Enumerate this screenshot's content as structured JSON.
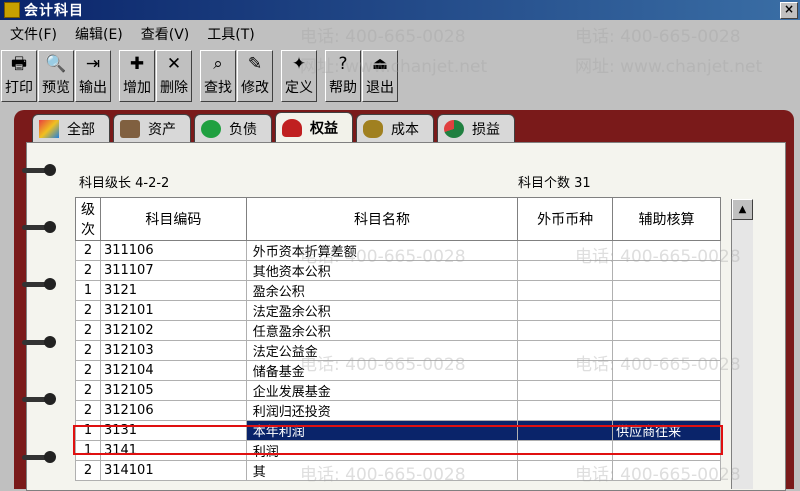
{
  "window": {
    "title": "会计科目",
    "close_label": "×"
  },
  "menu": [
    "文件(F)",
    "编辑(E)",
    "查看(V)",
    "工具(T)"
  ],
  "toolbar": [
    {
      "label": "打印",
      "icon": "printer-icon",
      "glyph": "🖶"
    },
    {
      "label": "预览",
      "icon": "preview-icon",
      "glyph": "🔍"
    },
    {
      "label": "输出",
      "icon": "export-icon",
      "glyph": "⇥"
    },
    {
      "label": "增加",
      "icon": "add-icon",
      "glyph": "✚"
    },
    {
      "label": "删除",
      "icon": "delete-icon",
      "glyph": "✕"
    },
    {
      "label": "查找",
      "icon": "find-icon",
      "glyph": "⌕"
    },
    {
      "label": "修改",
      "icon": "edit-icon",
      "glyph": "✎"
    },
    {
      "label": "定义",
      "icon": "define-icon",
      "glyph": "✦"
    },
    {
      "label": "帮助",
      "icon": "help-icon",
      "glyph": "?"
    },
    {
      "label": "退出",
      "icon": "exit-icon",
      "glyph": "⏏"
    }
  ],
  "tabs": [
    {
      "label": "全部",
      "icon": "all-icon",
      "color": "#e84040",
      "active": false
    },
    {
      "label": "资产",
      "icon": "assets-icon",
      "color": "#806040",
      "active": false
    },
    {
      "label": "负债",
      "icon": "liability-icon",
      "color": "#20a040",
      "active": false
    },
    {
      "label": "权益",
      "icon": "equity-icon",
      "color": "#c02020",
      "active": true
    },
    {
      "label": "成本",
      "icon": "cost-icon",
      "color": "#a08020",
      "active": false
    },
    {
      "label": "损益",
      "icon": "profit-loss-icon",
      "color": "#208040",
      "active": false
    }
  ],
  "info": {
    "level_text": "科目级长   4-2-2",
    "count_text": "科目个数   31"
  },
  "table": {
    "headers": [
      "级次",
      "科目编码",
      "科目名称",
      "外币币种",
      "辅助核算"
    ],
    "rows": [
      {
        "level": "2",
        "code": "311106",
        "name": "外币资本折算差额",
        "currency": "",
        "aux": ""
      },
      {
        "level": "2",
        "code": "311107",
        "name": "其他资本公积",
        "currency": "",
        "aux": ""
      },
      {
        "level": "1",
        "code": "3121",
        "name": "盈余公积",
        "currency": "",
        "aux": ""
      },
      {
        "level": "2",
        "code": "312101",
        "name": "法定盈余公积",
        "currency": "",
        "aux": ""
      },
      {
        "level": "2",
        "code": "312102",
        "name": "任意盈余公积",
        "currency": "",
        "aux": ""
      },
      {
        "level": "2",
        "code": "312103",
        "name": "法定公益金",
        "currency": "",
        "aux": ""
      },
      {
        "level": "2",
        "code": "312104",
        "name": "储备基金",
        "currency": "",
        "aux": ""
      },
      {
        "level": "2",
        "code": "312105",
        "name": "企业发展基金",
        "currency": "",
        "aux": ""
      },
      {
        "level": "2",
        "code": "312106",
        "name": "利润归还投资",
        "currency": "",
        "aux": ""
      },
      {
        "level": "1",
        "code": "3131",
        "name": "本年利润",
        "currency": "",
        "aux": "供应商往来",
        "selected": true
      },
      {
        "level": "1",
        "code": "3141",
        "name": "利润",
        "currency": "",
        "aux": ""
      },
      {
        "level": "2",
        "code": "314101",
        "name": "其",
        "currency": "",
        "aux": ""
      }
    ]
  },
  "watermark": {
    "phone": "电话: 400-665-0028",
    "site": "网址: www.chanjet.net"
  }
}
